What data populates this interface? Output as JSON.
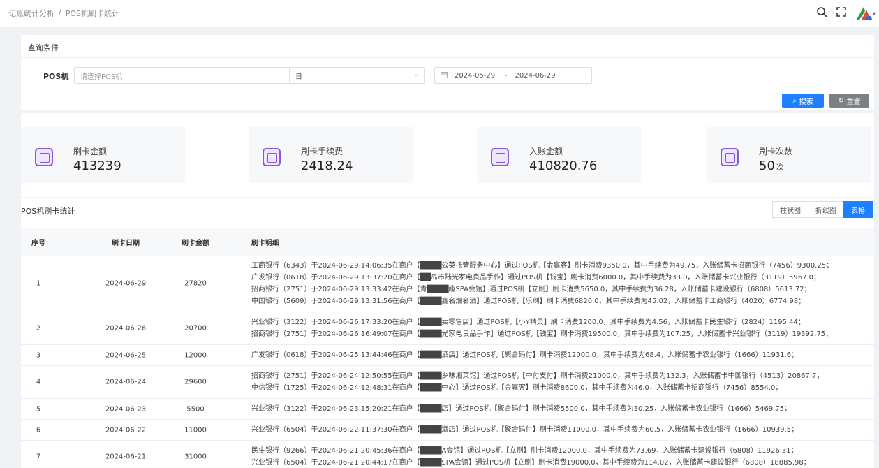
{
  "breadcrumb": [
    "记账统计分析",
    "/",
    "POS机刷卡统计"
  ],
  "query": {
    "title": "查询条件",
    "pos_label": "POS机",
    "pos_placeholder": "请选择POS机",
    "period_value": "日",
    "date_start": "2024-05-29",
    "date_sep": "~",
    "date_end": "2024-06-29",
    "search_label": "搜索",
    "reset_label": "重置"
  },
  "stats": [
    {
      "label": "刷卡金额",
      "value": "413239",
      "unit": ""
    },
    {
      "label": "刷卡手续费",
      "value": "2418.24",
      "unit": ""
    },
    {
      "label": "入账金额",
      "value": "410820.76",
      "unit": ""
    },
    {
      "label": "刷卡次数",
      "value": "50",
      "unit": "次"
    }
  ],
  "table": {
    "title": "POS机刷卡统计",
    "tabs": [
      "柱状图",
      "折线图",
      "表格"
    ],
    "active_tab": "表格",
    "headers": {
      "idx": "序号",
      "date": "刷卡日期",
      "amount": "刷卡金额",
      "detail": "刷卡明细"
    },
    "rows": [
      {
        "idx": "1",
        "date": "2024-06-29",
        "amount": "27820",
        "details": [
          "工商银行（6343）于2024-06-29 14:06:35在商户【████公英托管服务中心】通过POS机【金赢客】刷卡消费9350.0，其中手续费为49.75，入账储蓄卡招商银行（7456）9300.25；",
          "广发银行（0618）于2024-06-29 13:37:20在商户【██岛市陆光家电良品手作】通过POS机【钱宝】刷卡消费6000.0，其中手续费为33.0，入账储蓄卡兴业银行（3119）5967.0；",
          "招商银行（2751）于2024-06-29 13:33:42在商户【青████趣SPA会馆】通过POS机【立刷】刷卡消费5650.0，其中手续费为36.28，入账储蓄卡建设银行（6808）5613.72；",
          "中国银行（5609）于2024-06-29 13:31:56在商户【████鑫名烟名酒】通过POS机【乐刷】刷卡消费6820.0，其中手续费为45.02，入账储蓄卡工商银行（4020）6774.98；"
        ]
      },
      {
        "idx": "2",
        "date": "2024-06-26",
        "amount": "20700",
        "details": [
          "兴业银行（3122）于2024-06-26 17:33:20在商户【████卖零售店】通过POS机【小Y精灵】刷卡消费1200.0，其中手续费为4.56，入账储蓄卡民生银行（2824）1195.44；",
          "招商银行（2751）于2024-06-26 16:49:07在商户【████光家电良品手作】通过POS机【钱宝】刷卡消费19500.0，其中手续费为107.25，入账储蓄卡兴业银行（3119）19392.75；"
        ]
      },
      {
        "idx": "3",
        "date": "2024-06-25",
        "amount": "12000",
        "details": [
          "广发银行（0618）于2024-06-25 13:44:46在商户【████酒店】通过POS机【聚合码付】刷卡消费12000.0，其中手续费为68.4，入账储蓄卡农业银行（1666）11931.6；"
        ]
      },
      {
        "idx": "4",
        "date": "2024-06-24",
        "amount": "29600",
        "details": [
          "招商银行（2751）于2024-06-24 12:50:55在商户【████乡味湘菜馆】通过POS机【中付支付】刷卡消费21000.0，其中手续费为132.3，入账储蓄卡中国银行（4513）20867.7；",
          "中信银行（1725）于2024-06-24 12:48:31在商户【████中心】通过POS机【金赢客】刷卡消费8600.0，其中手续费为46.0，入账储蓄卡招商银行（7456）8554.0；"
        ]
      },
      {
        "idx": "5",
        "date": "2024-06-23",
        "amount": "5500",
        "details": [
          "兴业银行（3122）于2024-06-23 15:20:21在商户【████店】通过POS机【聚合码付】刷卡消费5500.0，其中手续费为30.25，入账储蓄卡农业银行（1666）5469.75；"
        ]
      },
      {
        "idx": "6",
        "date": "2024-06-22",
        "amount": "11000",
        "details": [
          "兴业银行（6504）于2024-06-22 11:37:30在商户【████酒店】通过POS机【聚合码付】刷卡消费11000.0，其中手续费为60.5，入账储蓄卡农业银行（1666）10939.5；"
        ]
      },
      {
        "idx": "7",
        "date": "2024-06-21",
        "amount": "31000",
        "details": [
          "民生银行（9266）于2024-06-21 20:45:36在商户【████A会馆】通过POS机【立刷】刷卡消费12000.0，其中手续费为73.69，入账储蓄卡建设银行（6808）11926.31；",
          "兴业银行（6504）于2024-06-21 20:44:17在商户【████SPA会馆】通过POS机【立刷】刷卡消费19000.0，其中手续费为114.02，入账储蓄卡建设银行（6808）18885.98；"
        ]
      }
    ]
  }
}
